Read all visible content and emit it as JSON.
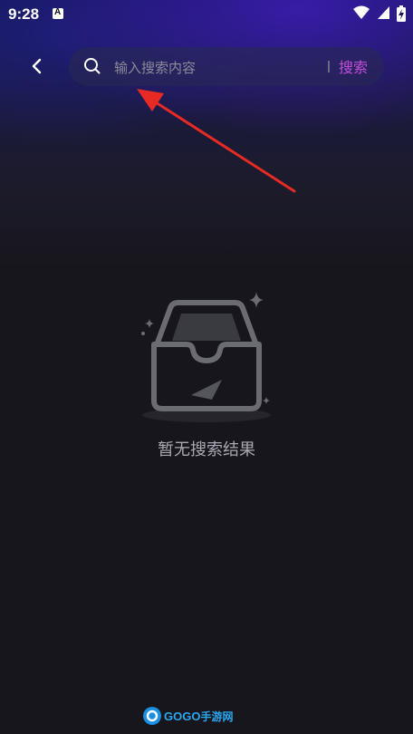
{
  "status_bar": {
    "time": "9:28",
    "notification_glyph": "A"
  },
  "header": {
    "search_placeholder": "输入搜索内容",
    "search_value": "",
    "search_button_label": "搜索"
  },
  "empty_state": {
    "message": "暂无搜索结果"
  },
  "watermark": {
    "brand": "GOGO",
    "suffix": "手游网"
  },
  "colors": {
    "accent": "#c14ed6",
    "background": "#17161c",
    "annotation_arrow": "#e82a25"
  }
}
